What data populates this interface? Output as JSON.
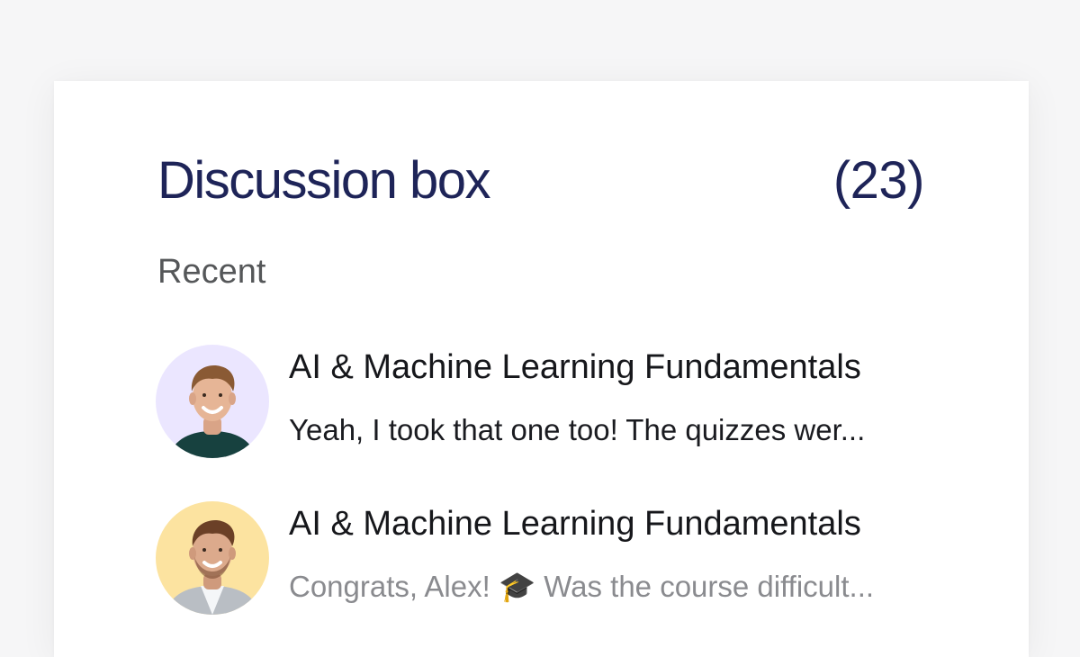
{
  "discussion": {
    "title": "Discussion box",
    "count": "(23)",
    "section_label": "Recent",
    "items": [
      {
        "title": "AI & Machine Learning Fundamentals",
        "preview": "Yeah, I took that one too! The quizzes wer...",
        "avatar_bg": "#ebe6ff",
        "preview_color": "#1a1b20"
      },
      {
        "title": "AI & Machine Learning Fundamentals",
        "preview": "Congrats, Alex! 🎓 Was the course difficult...",
        "avatar_bg": "#fce3a0",
        "preview_color": "#8a8b8f"
      }
    ]
  },
  "colors": {
    "title": "#1e2458",
    "page_background": "#f6f6f7",
    "card_background": "#ffffff"
  }
}
